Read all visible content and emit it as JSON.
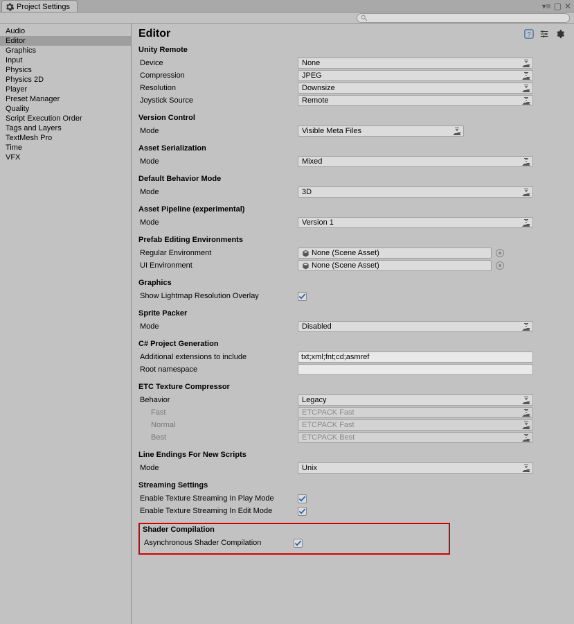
{
  "window": {
    "title": "Project Settings"
  },
  "sidebar": {
    "items": [
      "Audio",
      "Editor",
      "Graphics",
      "Input",
      "Physics",
      "Physics 2D",
      "Player",
      "Preset Manager",
      "Quality",
      "Script Execution Order",
      "Tags and Layers",
      "TextMesh Pro",
      "Time",
      "VFX"
    ],
    "selected": 1
  },
  "page": {
    "title": "Editor"
  },
  "sections": {
    "unityRemote": {
      "title": "Unity Remote",
      "device": {
        "label": "Device",
        "value": "None"
      },
      "compression": {
        "label": "Compression",
        "value": "JPEG"
      },
      "resolution": {
        "label": "Resolution",
        "value": "Downsize"
      },
      "joystick": {
        "label": "Joystick Source",
        "value": "Remote"
      }
    },
    "versionControl": {
      "title": "Version Control",
      "mode": {
        "label": "Mode",
        "value": "Visible Meta Files"
      }
    },
    "assetSerialization": {
      "title": "Asset Serialization",
      "mode": {
        "label": "Mode",
        "value": "Mixed"
      }
    },
    "defaultBehavior": {
      "title": "Default Behavior Mode",
      "mode": {
        "label": "Mode",
        "value": "3D"
      }
    },
    "assetPipeline": {
      "title": "Asset Pipeline (experimental)",
      "mode": {
        "label": "Mode",
        "value": "Version 1"
      }
    },
    "prefabEnv": {
      "title": "Prefab Editing Environments",
      "regular": {
        "label": "Regular Environment",
        "value": "None (Scene Asset)"
      },
      "ui": {
        "label": "UI Environment",
        "value": "None (Scene Asset)"
      }
    },
    "graphics": {
      "title": "Graphics",
      "lightmap": {
        "label": "Show Lightmap Resolution Overlay",
        "checked": true
      }
    },
    "spritePacker": {
      "title": "Sprite Packer",
      "mode": {
        "label": "Mode",
        "value": "Disabled"
      }
    },
    "csharp": {
      "title": "C# Project Generation",
      "extensions": {
        "label": "Additional extensions to include",
        "value": "txt;xml;fnt;cd;asmref"
      },
      "rootns": {
        "label": "Root namespace",
        "value": ""
      }
    },
    "etc": {
      "title": "ETC Texture Compressor",
      "behavior": {
        "label": "Behavior",
        "value": "Legacy"
      },
      "fast": {
        "label": "Fast",
        "value": "ETCPACK Fast"
      },
      "normal": {
        "label": "Normal",
        "value": "ETCPACK Fast"
      },
      "best": {
        "label": "Best",
        "value": "ETCPACK Best"
      }
    },
    "lineEndings": {
      "title": "Line Endings For New Scripts",
      "mode": {
        "label": "Mode",
        "value": "Unix"
      }
    },
    "streaming": {
      "title": "Streaming Settings",
      "play": {
        "label": "Enable Texture Streaming In Play Mode",
        "checked": true
      },
      "edit": {
        "label": "Enable Texture Streaming In Edit Mode",
        "checked": true
      }
    },
    "shader": {
      "title": "Shader Compilation",
      "async": {
        "label": "Asynchronous Shader Compilation",
        "checked": true
      }
    }
  }
}
